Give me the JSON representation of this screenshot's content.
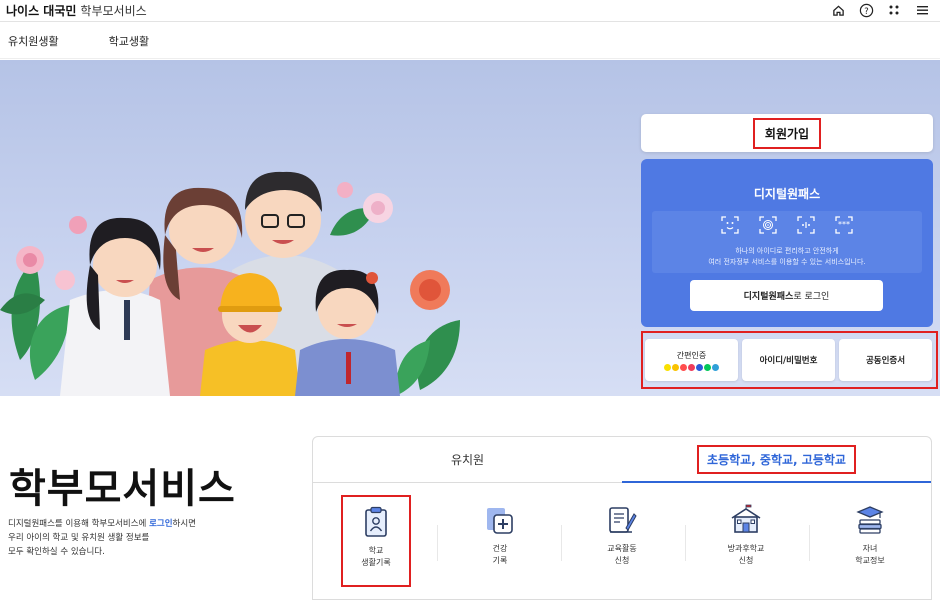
{
  "app": {
    "brand_bold": "나이스 대국민",
    "brand_sub": "학부모서비스"
  },
  "top_icons": [
    "home-icon",
    "help-icon",
    "apps-grid-icon",
    "menu-icon"
  ],
  "nav": {
    "items": [
      {
        "label": "유치원생활"
      },
      {
        "label": "학교생활"
      }
    ]
  },
  "right_panel": {
    "signup_label": "회원가입",
    "digital_pass": {
      "title": "디지털원패스",
      "desc_line1": "하나의 아이디로 편리하고 안전하게",
      "desc_line2": "여러 전자정부 서비스를 이용할 수 있는 서비스입니다.",
      "login_bold": "디지털원패스",
      "login_rest": "로 로그인",
      "icons": [
        "face-id-icon",
        "fingerprint-icon",
        "pattern-icon",
        "pin-icon"
      ]
    },
    "auth": {
      "simple_label": "간편인증",
      "id_pw_label": "아이디/비밀번호",
      "cert_label": "공동인증서",
      "provider_colors": [
        "#f9e000",
        "#f9c200",
        "#ff4d4d",
        "#ef3c5a",
        "#2c5bd9",
        "#03c75a",
        "#2fa0d8"
      ]
    }
  },
  "main": {
    "title": "학부모서비스",
    "desc_line1_pre": "디지털원패스를 이용해 학부모서비스에 ",
    "desc_link": "로그인",
    "desc_line1_post": "하시면",
    "desc_line2": "우리 아이의 학교 및 유치원 생활 정보를",
    "desc_line3": "모두 확인하실 수 있습니다."
  },
  "tabs": {
    "kindergarten": "유치원",
    "schools": "초등학교, 중학교, 고등학교"
  },
  "services": [
    {
      "line1": "학교",
      "line2": "생활기록",
      "icon": "student-record-icon"
    },
    {
      "line1": "건강",
      "line2": "기록",
      "icon": "health-record-icon"
    },
    {
      "line1": "교육활동",
      "line2": "신청",
      "icon": "activity-application-icon"
    },
    {
      "line1": "방과후학교",
      "line2": "신청",
      "icon": "after-school-icon"
    },
    {
      "line1": "자녀",
      "line2": "학교정보",
      "icon": "school-info-icon"
    }
  ]
}
